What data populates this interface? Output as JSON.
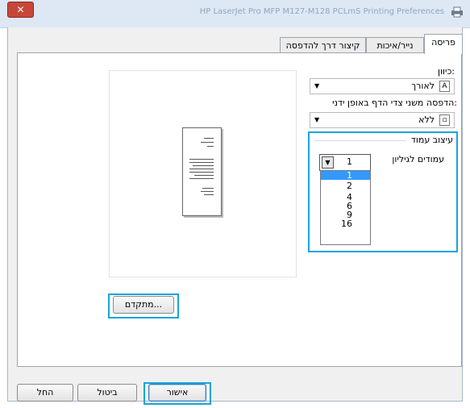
{
  "window": {
    "title": "HP LaserJet Pro MFP M127-M128 PCLmS Printing Preferences",
    "close_label": "✕"
  },
  "tabs": [
    {
      "label": "פריסה"
    },
    {
      "label": "נייר/איכות"
    },
    {
      "label": "קיצור דרך להדפסה"
    }
  ],
  "orientation": {
    "label": "כיוון:",
    "value": "לאורך",
    "icon": "portrait-page-icon"
  },
  "duplex": {
    "label": "הדפסה משני צדי הדף באופן ידני:",
    "value": "ללא",
    "icon": "duplex-page-icon"
  },
  "page_format": {
    "group_label": "עיצוב עמוד",
    "pages_per_sheet_label": "עמודים לגיליון",
    "selected": "1",
    "options": [
      "1",
      "2",
      "4",
      "6",
      "9",
      "16"
    ]
  },
  "advanced_button": "מתקדם...",
  "footer": {
    "ok": "אישור",
    "cancel": "ביטול",
    "apply": "החל"
  },
  "colors": {
    "highlight": "#1aa3dd",
    "selection": "#3399ff"
  }
}
